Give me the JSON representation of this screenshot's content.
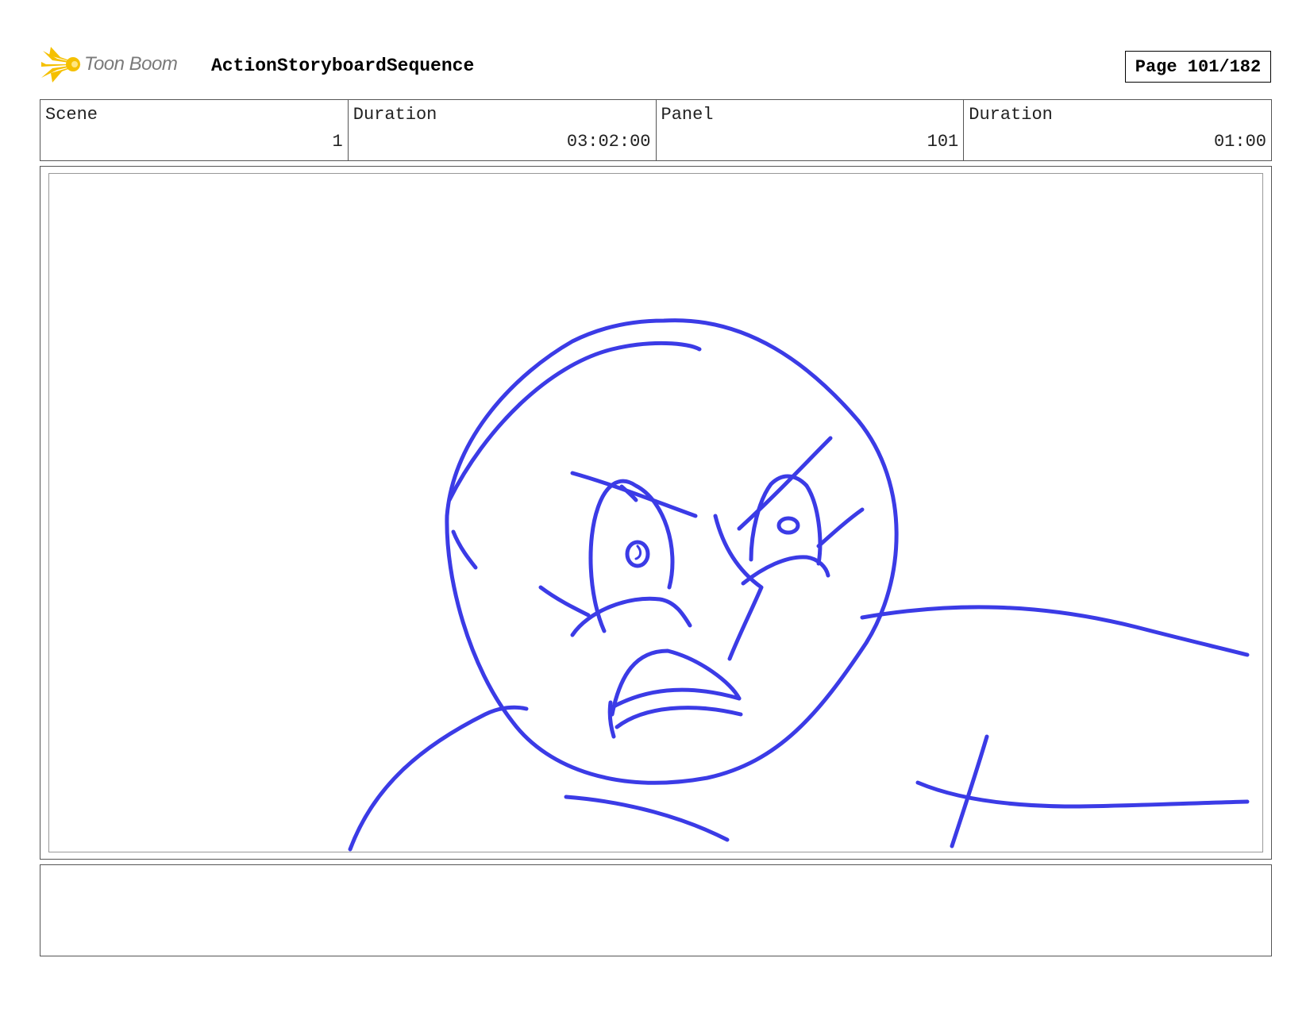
{
  "header": {
    "logo_text": "Toon Boom",
    "project_title": "ActionStoryboardSequence",
    "page_label": "Page 101/182"
  },
  "info": {
    "scene_label": "Scene",
    "scene_value": "1",
    "scene_duration_label": "Duration",
    "scene_duration_value": "03:02:00",
    "panel_label": "Panel",
    "panel_value": "101",
    "panel_duration_label": "Duration",
    "panel_duration_value": "01:00"
  },
  "colors": {
    "sketch": "#3b3be6",
    "logo_flare": "#f5c000"
  },
  "notes": ""
}
